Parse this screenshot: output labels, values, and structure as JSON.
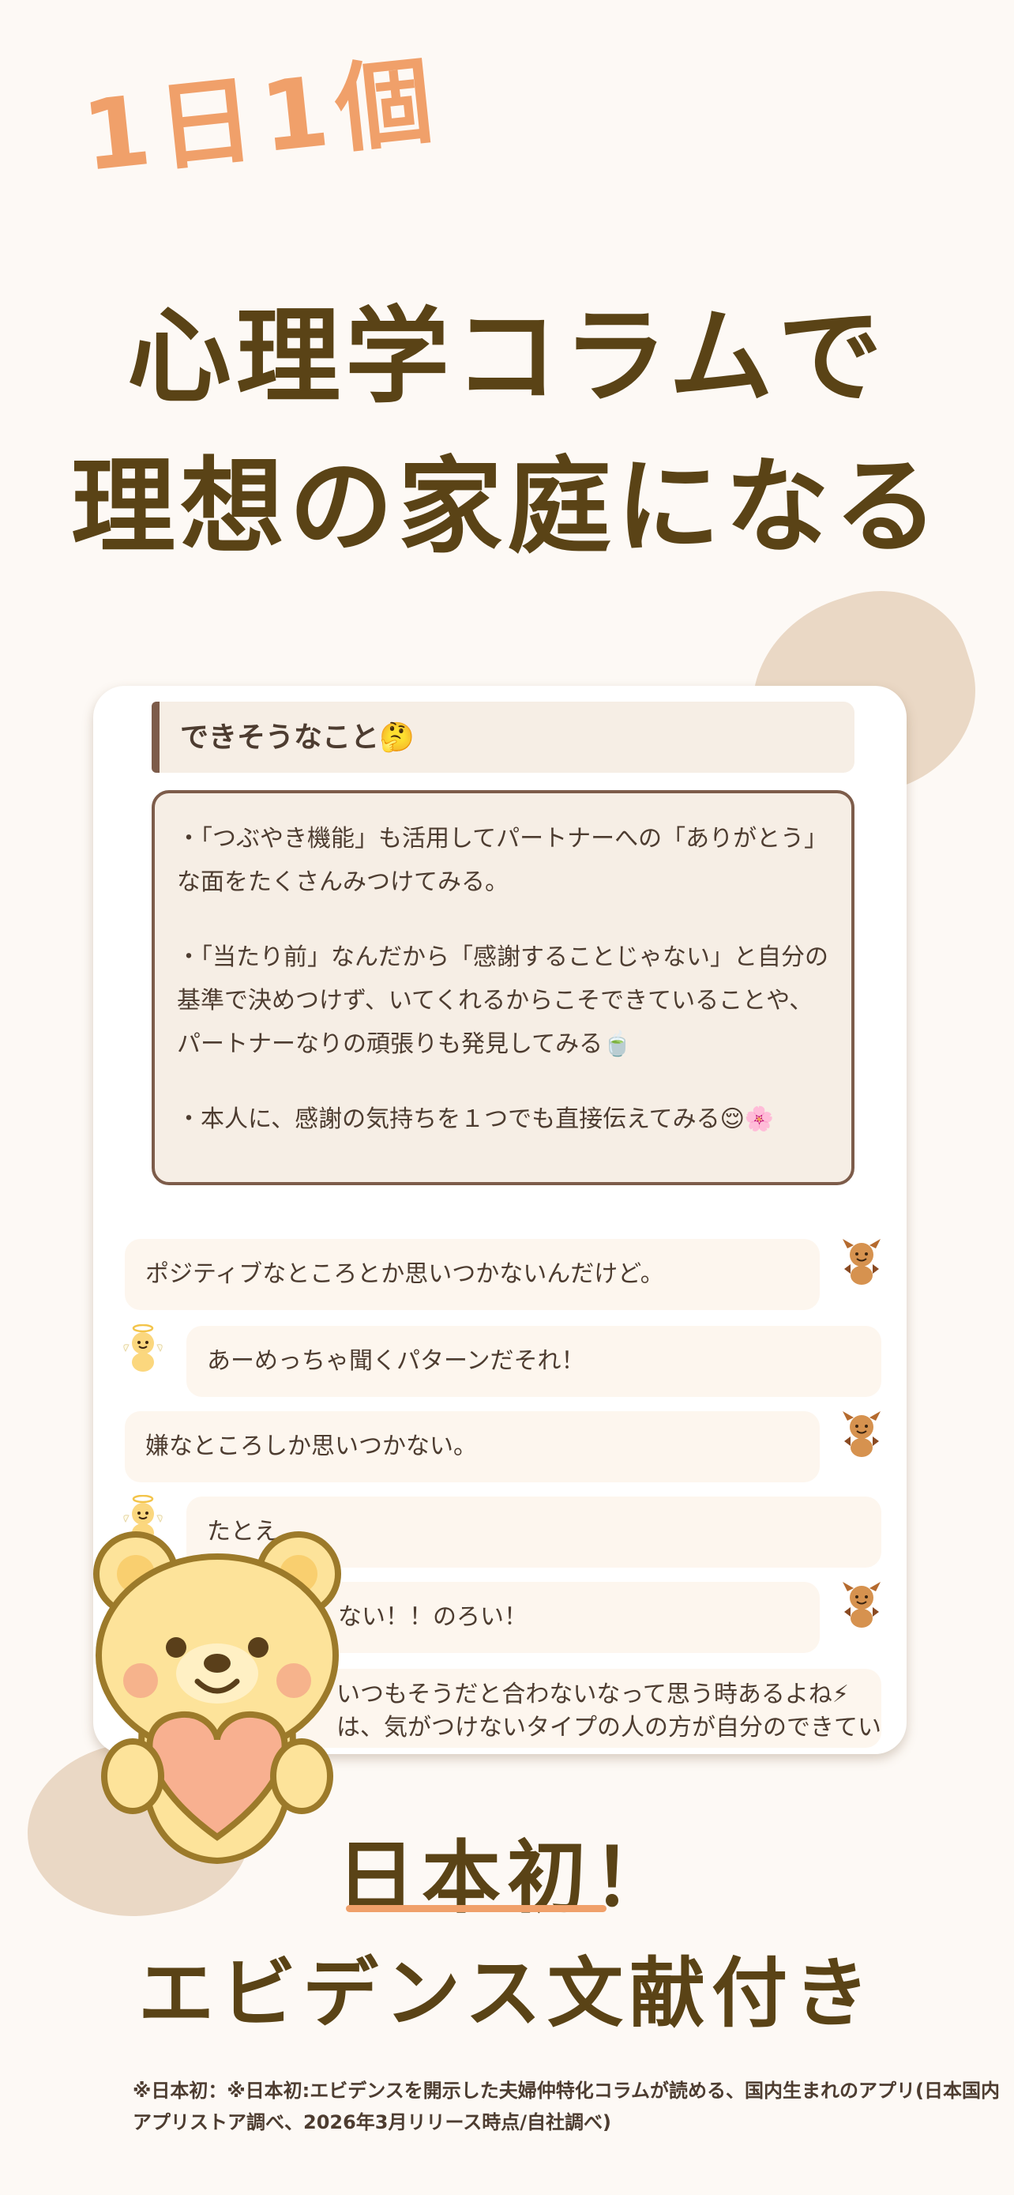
{
  "hero": {
    "tagline": "1日1個",
    "headline_line1": "心理学コラムで",
    "headline_line2": "理想の家庭になる"
  },
  "card": {
    "tip_header": "できそうなこと🤔",
    "tips": [
      "・「つぶやき機能」も活用してパートナーへの「ありがとう」な面をたくさんみつけてみる。",
      "・「当たり前」なんだから「感謝することじゃない」と自分の基準で決めつけず、いてくれるからこそできていることや、パートナーなりの頑張りも発見してみる🍵",
      "・本人に、感謝の気持ちを１つでも直接伝えてみる😌🌸"
    ],
    "chat": [
      {
        "side": "left",
        "speaker": "devil",
        "text": "ポジティブなところとか思いつかないんだけど。"
      },
      {
        "side": "right",
        "speaker": "angel",
        "text": "あーめっちゃ聞くパターンだそれ！"
      },
      {
        "side": "left",
        "speaker": "devil",
        "text": "嫌なところしか思いつかない。"
      },
      {
        "side": "right",
        "speaker": "angel",
        "text": "たとえ"
      },
      {
        "side": "left",
        "speaker": "devil",
        "text": "ない！！のろい！"
      },
      {
        "side": "right",
        "speaker": "angel",
        "text": "いつもそうだと合わないなって思う時あるよね⚡\nは、気がつけないタイプの人の方が自分のできてい"
      }
    ]
  },
  "claim": {
    "line1": "日本初！",
    "line2": "エビデンス文献付き"
  },
  "footnote": "※日本初：※日本初:エビデンスを開示した夫婦仲特化コラムが読める、国内生まれのアプリ(日本国内アプリストア調べ、2026年3月リリース時点/自社調べ)",
  "icons": {
    "devil_avatar": "devil-bear-icon",
    "angel_avatar": "angel-bear-icon",
    "mascot": "bear-holding-heart-mascot"
  },
  "colors": {
    "background": "#fdf9f5",
    "accent_orange": "#f0a06a",
    "headline_brown": "#5a4316",
    "card_border": "#7d5c4a"
  }
}
